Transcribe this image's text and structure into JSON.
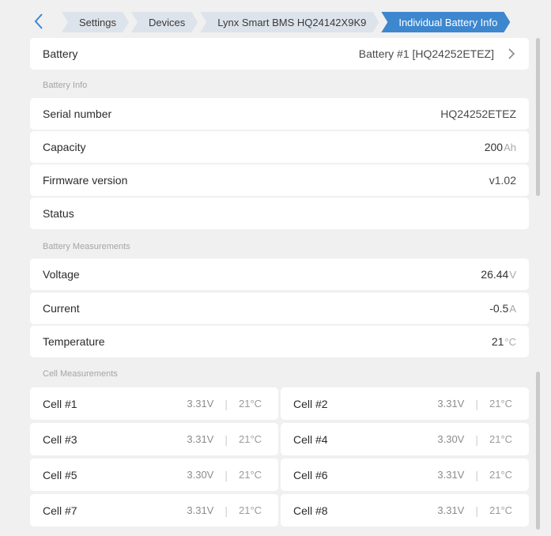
{
  "breadcrumb": [
    "Settings",
    "Devices",
    "Lynx Smart BMS HQ24142X9K9",
    "Individual Battery Info"
  ],
  "battery_row": {
    "label": "Battery",
    "value": "Battery #1 [HQ24252ETEZ]"
  },
  "sections": {
    "info": "Battery Info",
    "measurements": "Battery Measurements",
    "cells": "Cell Measurements"
  },
  "info": {
    "serial_label": "Serial number",
    "serial_value": "HQ24252ETEZ",
    "capacity_label": "Capacity",
    "capacity_value": "200",
    "capacity_unit": "Ah",
    "firmware_label": "Firmware version",
    "firmware_value": "v1.02",
    "status_label": "Status"
  },
  "measurements": {
    "voltage_label": "Voltage",
    "voltage_value": "26.44",
    "voltage_unit": "V",
    "current_label": "Current",
    "current_value": "-0.5",
    "current_unit": "A",
    "temperature_label": "Temperature",
    "temperature_value": "21",
    "temperature_unit": "°C"
  },
  "cells": [
    {
      "name": "Cell #1",
      "voltage": "3.31V",
      "temp": "21°C"
    },
    {
      "name": "Cell #2",
      "voltage": "3.31V",
      "temp": "21°C"
    },
    {
      "name": "Cell #3",
      "voltage": "3.31V",
      "temp": "21°C"
    },
    {
      "name": "Cell #4",
      "voltage": "3.30V",
      "temp": "21°C"
    },
    {
      "name": "Cell #5",
      "voltage": "3.30V",
      "temp": "21°C"
    },
    {
      "name": "Cell #6",
      "voltage": "3.31V",
      "temp": "21°C"
    },
    {
      "name": "Cell #7",
      "voltage": "3.31V",
      "temp": "21°C"
    },
    {
      "name": "Cell #8",
      "voltage": "3.31V",
      "temp": "21°C"
    }
  ],
  "separator": "|",
  "icons": {
    "back": "chevron-left-icon",
    "battery_more": "chevron-right-icon"
  },
  "colors": {
    "accent": "#3d87cf",
    "crumb": "#dde3ea",
    "background": "#f0f0f0"
  }
}
